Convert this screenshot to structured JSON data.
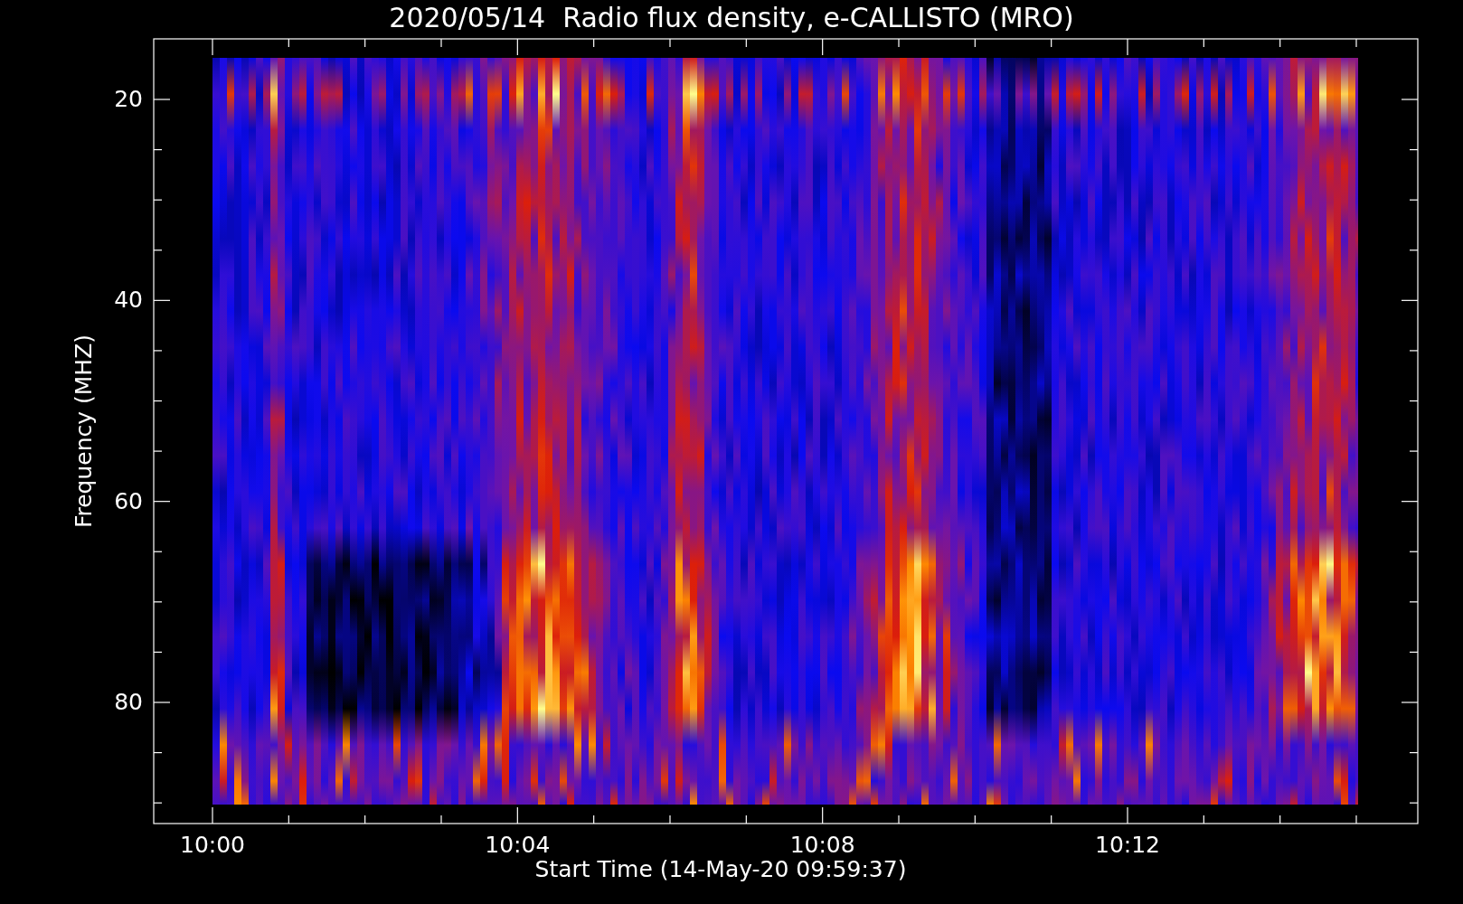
{
  "title": "2020/05/14  Radio flux density, e-CALLISTO (MRO)",
  "y_axis": {
    "label": "Frequency (MHZ)",
    "ticks": [
      "20",
      "40",
      "60",
      "80"
    ]
  },
  "x_axis": {
    "label": "Start Time (14-May-20 09:59:37)",
    "ticks": [
      "10:00",
      "10:04",
      "10:08",
      "10:12"
    ]
  }
}
